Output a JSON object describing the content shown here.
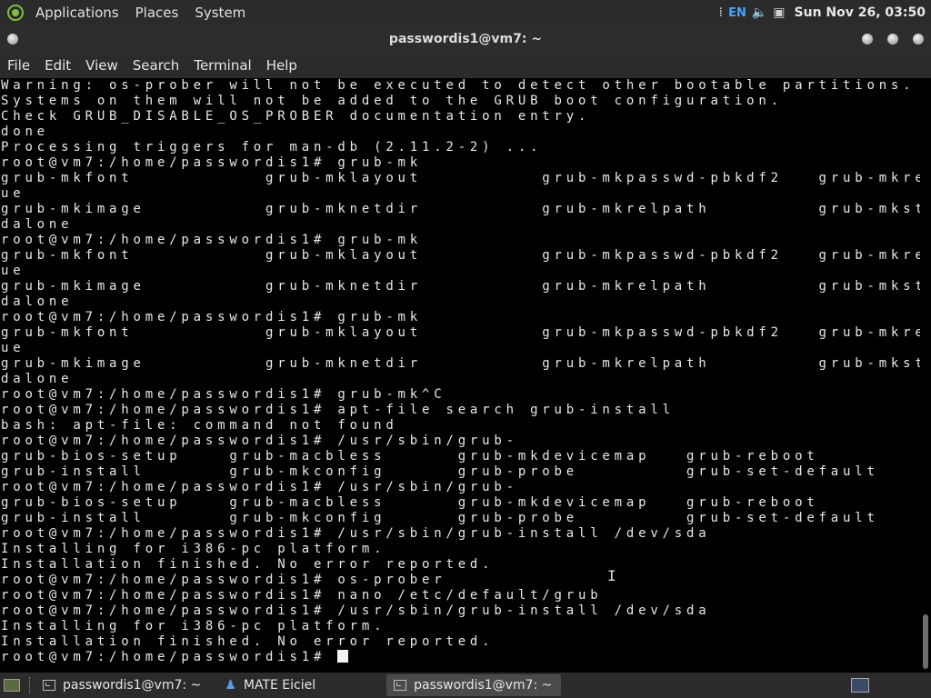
{
  "top_panel": {
    "menus": [
      "Applications",
      "Places",
      "System"
    ],
    "keyboard_layout": "EN",
    "clock": "Sun Nov 26, 03:50"
  },
  "window": {
    "title": "passwordis1@vm7: ~"
  },
  "menubar": {
    "items": [
      "File",
      "Edit",
      "View",
      "Search",
      "Terminal",
      "Help"
    ]
  },
  "terminal": {
    "lines": [
      "Warning: os-prober will not be executed to detect other bootable partitions.",
      "Systems on them will not be added to the GRUB boot configuration.",
      "Check GRUB_DISABLE_OS_PROBER documentation entry.",
      "done",
      "Processing triggers for man-db (2.11.2-2) ...",
      "root@vm7:/home/passwordis1# grub-mk",
      "grub-mkfont           grub-mklayout          grub-mkpasswd-pbkdf2   grub-mkresc",
      "ue",
      "grub-mkimage          grub-mknetdir          grub-mkrelpath         grub-mkstan",
      "dalone",
      "root@vm7:/home/passwordis1# grub-mk",
      "grub-mkfont           grub-mklayout          grub-mkpasswd-pbkdf2   grub-mkresc",
      "ue",
      "grub-mkimage          grub-mknetdir          grub-mkrelpath         grub-mkstan",
      "dalone",
      "root@vm7:/home/passwordis1# grub-mk",
      "grub-mkfont           grub-mklayout          grub-mkpasswd-pbkdf2   grub-mkresc",
      "ue",
      "grub-mkimage          grub-mknetdir          grub-mkrelpath         grub-mkstan",
      "dalone",
      "root@vm7:/home/passwordis1# grub-mk^C",
      "root@vm7:/home/passwordis1# apt-file search grub-install",
      "bash: apt-file: command not found",
      "root@vm7:/home/passwordis1# /usr/sbin/grub-",
      "grub-bios-setup    grub-macbless      grub-mkdevicemap   grub-reboot",
      "grub-install       grub-mkconfig      grub-probe         grub-set-default",
      "root@vm7:/home/passwordis1# /usr/sbin/grub-",
      "grub-bios-setup    grub-macbless      grub-mkdevicemap   grub-reboot",
      "grub-install       grub-mkconfig      grub-probe         grub-set-default",
      "root@vm7:/home/passwordis1# /usr/sbin/grub-install /dev/sda",
      "Installing for i386-pc platform.",
      "Installation finished. No error reported.",
      "root@vm7:/home/passwordis1# os-prober",
      "root@vm7:/home/passwordis1# nano /etc/default/grub",
      "root@vm7:/home/passwordis1# /usr/sbin/grub-install /dev/sda",
      "Installing for i386-pc platform.",
      "Installation finished. No error reported."
    ],
    "prompt": "root@vm7:/home/passwordis1# "
  },
  "taskbar": {
    "tasks": [
      "passwordis1@vm7: ~",
      "MATE Eiciel",
      "passwordis1@vm7: ~"
    ]
  }
}
